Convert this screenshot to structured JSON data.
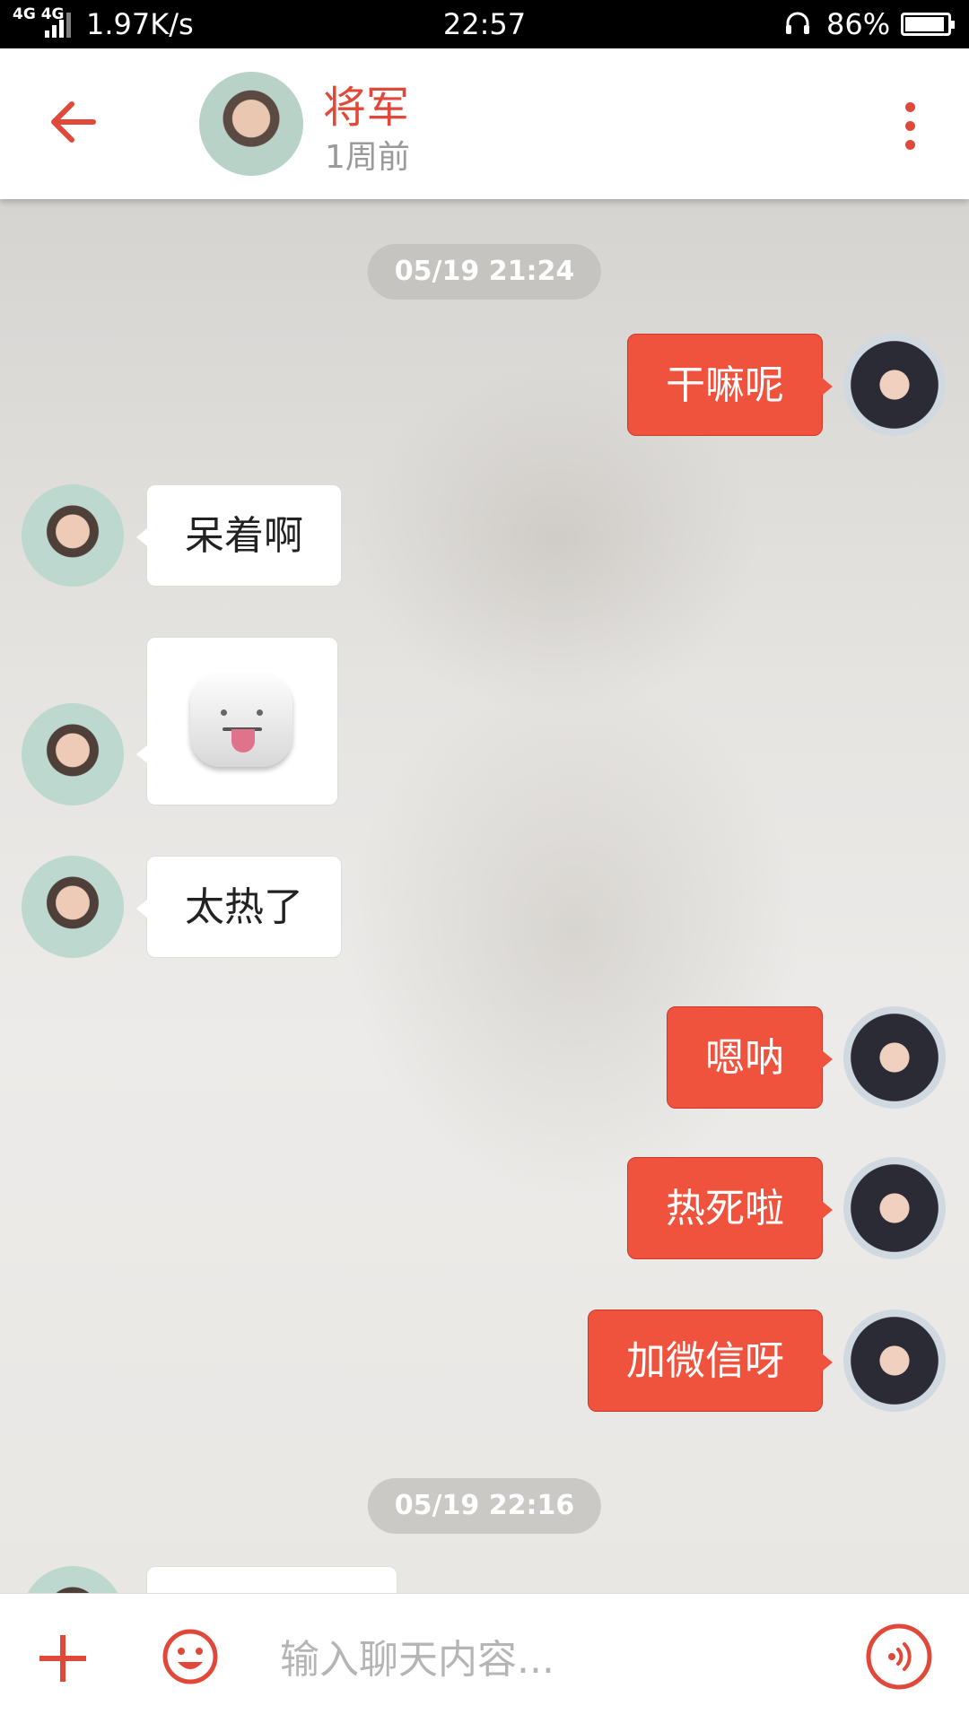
{
  "status_bar": {
    "network": "4G 4G",
    "speed": "1.97K/s",
    "time": "22:57",
    "battery": "86%",
    "battery_level": 0.86
  },
  "header": {
    "contact_name": "将军",
    "last_seen": "1周前",
    "accent_color": "#e0493a"
  },
  "messages": [
    {
      "type": "time",
      "text": "05/19  21:24"
    },
    {
      "type": "text",
      "from": "me",
      "text": "干嘛呢"
    },
    {
      "type": "text",
      "from": "them",
      "text": "呆着啊"
    },
    {
      "type": "sticker",
      "from": "them",
      "icon": "tongue-out-face-sticker"
    },
    {
      "type": "text",
      "from": "them",
      "text": "太热了"
    },
    {
      "type": "text",
      "from": "me",
      "text": "嗯呐"
    },
    {
      "type": "text",
      "from": "me",
      "text": "热死啦"
    },
    {
      "type": "text",
      "from": "me",
      "text": "加微信呀"
    },
    {
      "type": "time",
      "text": "05/19  22:16"
    }
  ],
  "input_bar": {
    "placeholder": "输入聊天内容..."
  }
}
